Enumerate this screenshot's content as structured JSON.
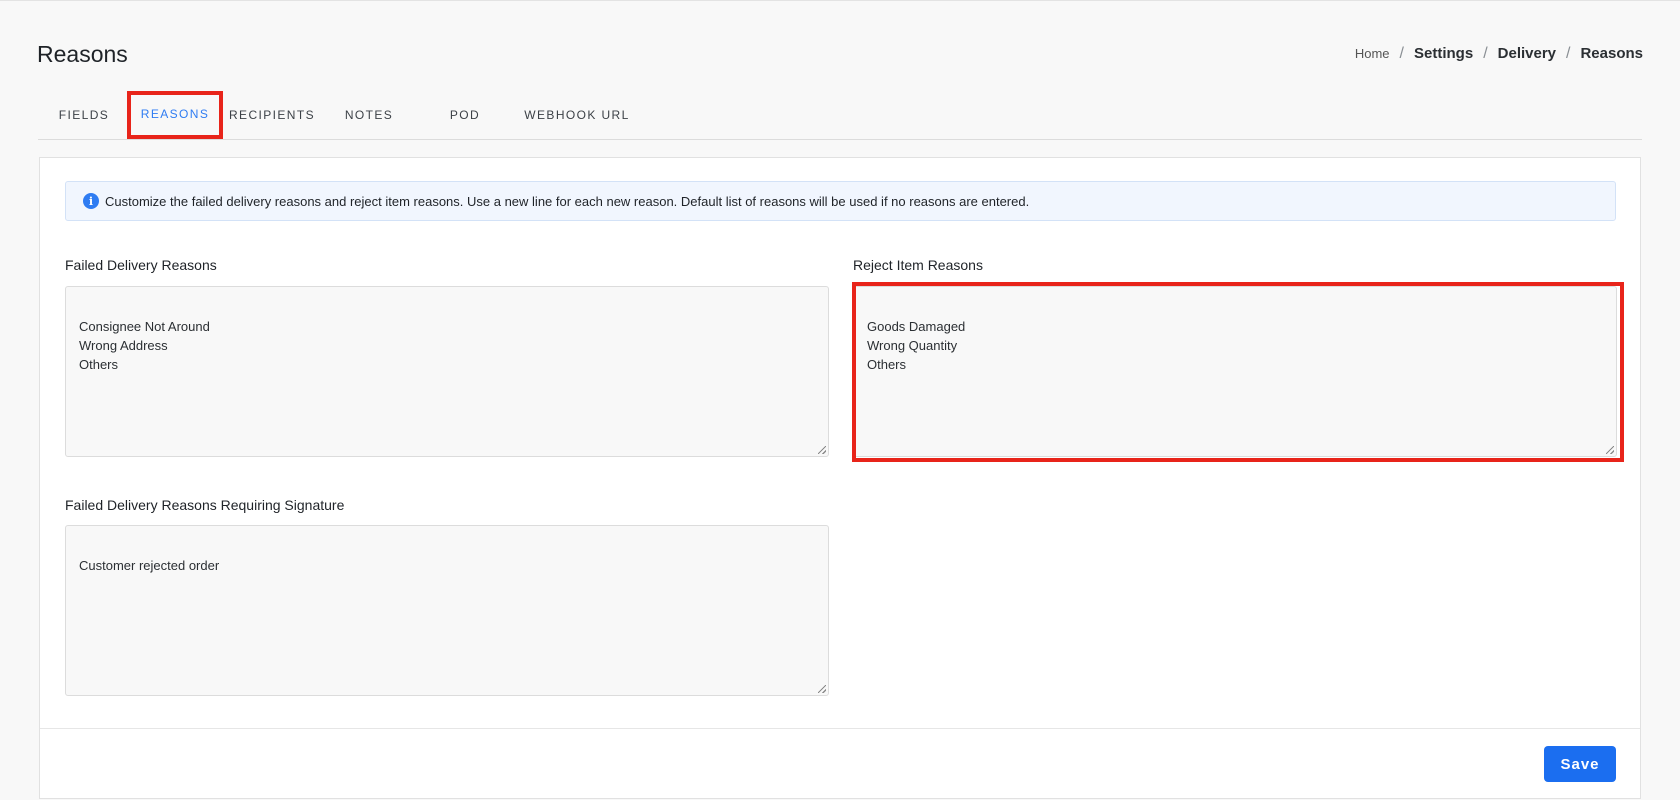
{
  "header": {
    "title": "Reasons",
    "breadcrumb": {
      "home": "Home",
      "sep": "/",
      "settings": "Settings",
      "delivery": "Delivery",
      "current": "Reasons"
    }
  },
  "tabs": [
    {
      "label": "FIELDS"
    },
    {
      "label": "REASONS",
      "active": true
    },
    {
      "label": "RECIPIENTS"
    },
    {
      "label": "NOTES"
    },
    {
      "label": "POD"
    },
    {
      "label": "WEBHOOK URL"
    }
  ],
  "alert": {
    "icon": "info-icon",
    "icon_glyph": "i",
    "text": "Customize the failed delivery reasons and reject item reasons. Use a new line for each new reason. Default list of reasons will be used if no reasons are entered."
  },
  "fields": {
    "failed_delivery": {
      "label": "Failed Delivery Reasons",
      "value": "Consignee Not Around\nWrong Address\nOthers"
    },
    "reject_item": {
      "label": "Reject Item Reasons",
      "value": "Goods Damaged\nWrong Quantity\nOthers"
    },
    "failed_signature": {
      "label": "Failed Delivery Reasons Requiring Signature",
      "value": "Customer rejected order"
    }
  },
  "footer": {
    "save_label": "Save"
  },
  "colors": {
    "accent": "#2f7cf2",
    "button": "#1b6ef0",
    "highlight": "#e8241a"
  }
}
